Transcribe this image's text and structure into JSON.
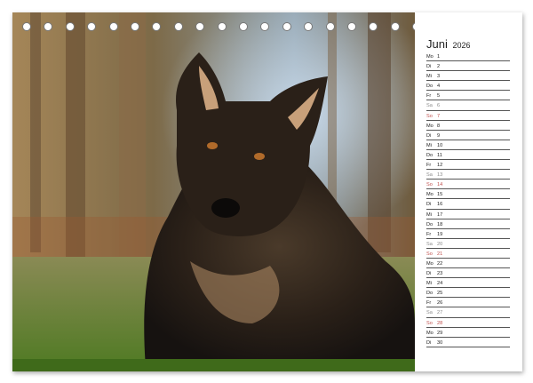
{
  "calendar": {
    "month": "Juni",
    "year": "2026"
  },
  "photo": {
    "subject": "dog-photo"
  },
  "days": [
    {
      "wd": "Mo",
      "d": "1",
      "type": "weekday"
    },
    {
      "wd": "Di",
      "d": "2",
      "type": "weekday"
    },
    {
      "wd": "Mi",
      "d": "3",
      "type": "weekday"
    },
    {
      "wd": "Do",
      "d": "4",
      "type": "weekday"
    },
    {
      "wd": "Fr",
      "d": "5",
      "type": "weekday"
    },
    {
      "wd": "Sa",
      "d": "6",
      "type": "sat"
    },
    {
      "wd": "So",
      "d": "7",
      "type": "sun"
    },
    {
      "wd": "Mo",
      "d": "8",
      "type": "weekday"
    },
    {
      "wd": "Di",
      "d": "9",
      "type": "weekday"
    },
    {
      "wd": "Mi",
      "d": "10",
      "type": "weekday"
    },
    {
      "wd": "Do",
      "d": "11",
      "type": "weekday"
    },
    {
      "wd": "Fr",
      "d": "12",
      "type": "weekday"
    },
    {
      "wd": "Sa",
      "d": "13",
      "type": "sat"
    },
    {
      "wd": "So",
      "d": "14",
      "type": "sun"
    },
    {
      "wd": "Mo",
      "d": "15",
      "type": "weekday"
    },
    {
      "wd": "Di",
      "d": "16",
      "type": "weekday"
    },
    {
      "wd": "Mi",
      "d": "17",
      "type": "weekday"
    },
    {
      "wd": "Do",
      "d": "18",
      "type": "weekday"
    },
    {
      "wd": "Fr",
      "d": "19",
      "type": "weekday"
    },
    {
      "wd": "Sa",
      "d": "20",
      "type": "sat"
    },
    {
      "wd": "So",
      "d": "21",
      "type": "sun"
    },
    {
      "wd": "Mo",
      "d": "22",
      "type": "weekday"
    },
    {
      "wd": "Di",
      "d": "23",
      "type": "weekday"
    },
    {
      "wd": "Mi",
      "d": "24",
      "type": "weekday"
    },
    {
      "wd": "Do",
      "d": "25",
      "type": "weekday"
    },
    {
      "wd": "Fr",
      "d": "26",
      "type": "weekday"
    },
    {
      "wd": "Sa",
      "d": "27",
      "type": "sat"
    },
    {
      "wd": "So",
      "d": "28",
      "type": "sun"
    },
    {
      "wd": "Mo",
      "d": "29",
      "type": "weekday"
    },
    {
      "wd": "Di",
      "d": "30",
      "type": "weekday"
    }
  ],
  "colors": {
    "sunday": "#c0504d",
    "saturday": "#8a8a8a",
    "text": "#222222"
  }
}
